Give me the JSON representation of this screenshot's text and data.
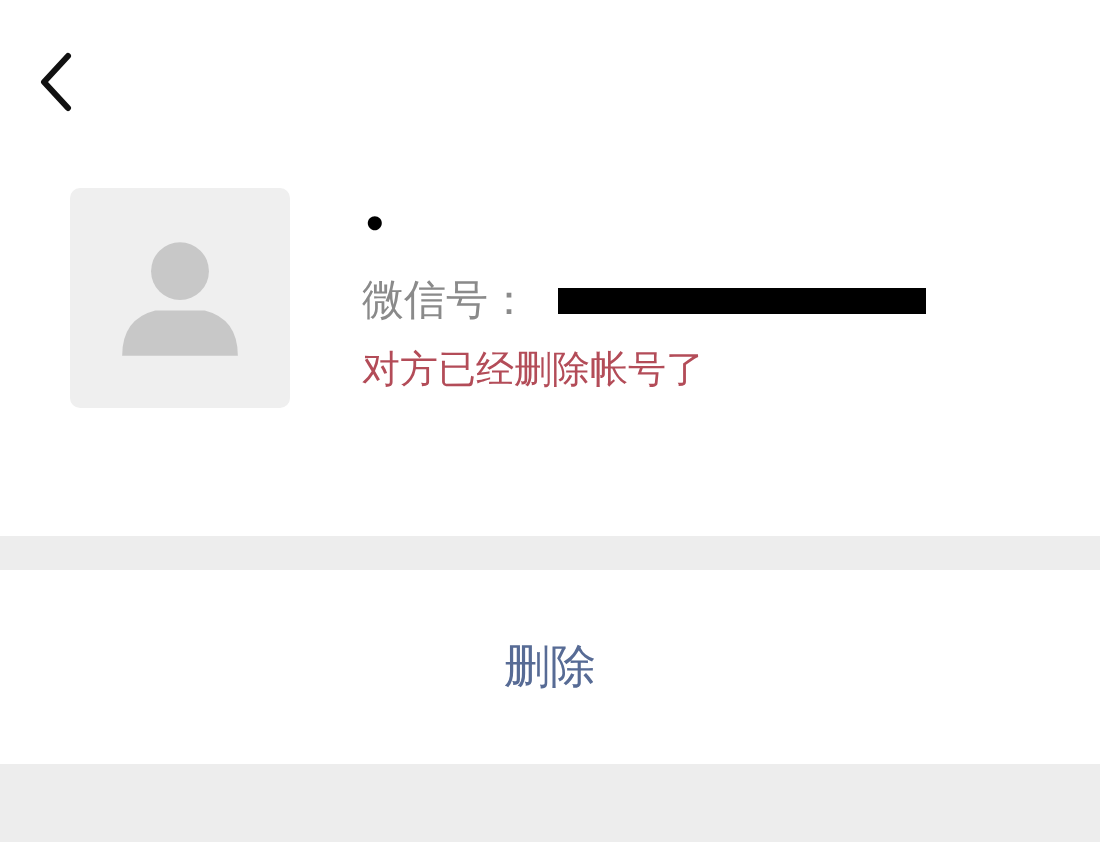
{
  "profile": {
    "nickname": "•",
    "wechat_id": {
      "label": "微信号：",
      "redacted": true
    },
    "status": "对方已经删除帐号了"
  },
  "actions": [
    {
      "label": "删除",
      "kind": "link"
    }
  ]
}
